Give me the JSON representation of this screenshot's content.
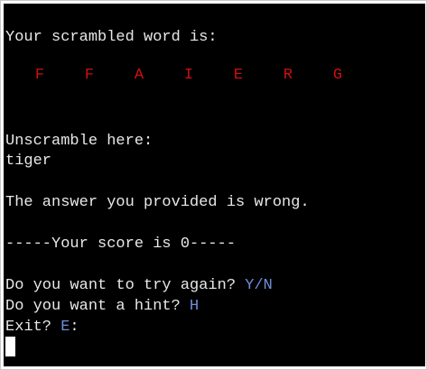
{
  "terminal": {
    "heading": "Your scrambled word is:",
    "scrambled_letters": [
      "F",
      "F",
      "A",
      "I",
      "E",
      "R",
      "G"
    ],
    "prompt_label": "Unscramble here:",
    "user_input": "tiger",
    "result_message": "The answer you provided is wrong.",
    "score_line": "-----Your score is 0-----",
    "try_again_text": "Do you want to try again? ",
    "try_again_key": "Y/N",
    "hint_text": "Do you want a hint? ",
    "hint_key": "H",
    "exit_text": "Exit? ",
    "exit_key": "E",
    "exit_suffix": ":"
  },
  "colors": {
    "background": "#000000",
    "text": "#e8e8e8",
    "scrambled_letters": "#d10f0f",
    "key_hint": "#6f8ed8"
  }
}
